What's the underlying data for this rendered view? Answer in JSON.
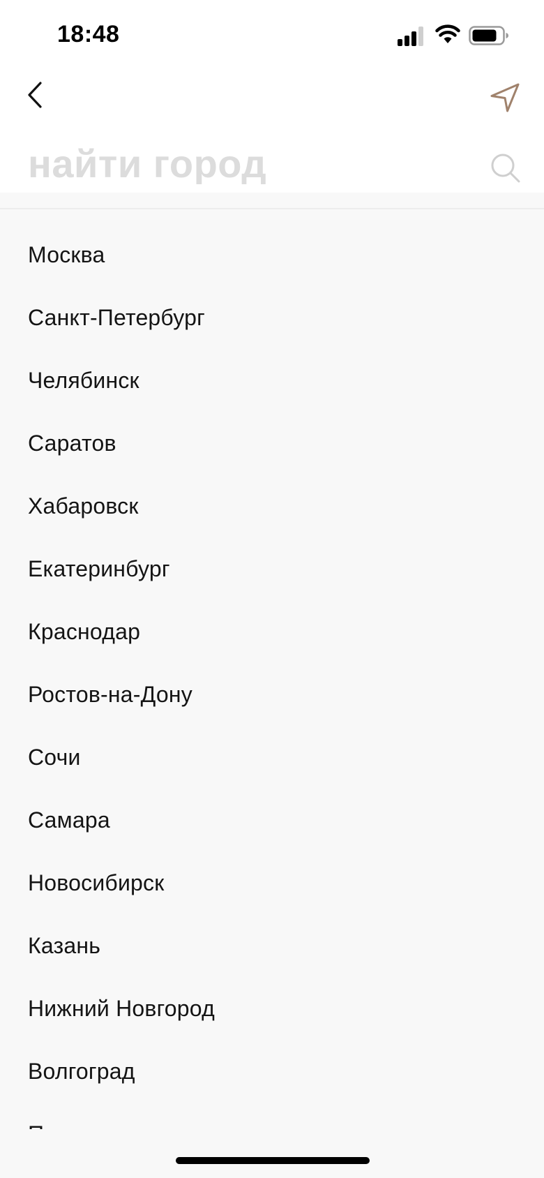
{
  "status_bar": {
    "time": "18:48",
    "icons": [
      "signal-icon",
      "wifi-icon",
      "battery-icon"
    ]
  },
  "header": {
    "back_icon": "chevron-left-icon",
    "locate_icon": "location-arrow-icon",
    "search_placeholder": "найти город",
    "search_value": "",
    "search_icon": "search-icon"
  },
  "cities": [
    "Москва",
    "Санкт-Петербург",
    "Челябинск",
    "Саратов",
    "Хабаровск",
    "Екатеринбург",
    "Краснодар",
    "Ростов-на-Дону",
    "Сочи",
    "Самара",
    "Новосибирск",
    "Казань",
    "Нижний Новгород",
    "Волгоград",
    "Пермь"
  ],
  "colors": {
    "accent": "#a0826c",
    "placeholder": "#dcdcdc",
    "list_background": "#f8f8f8",
    "header_background": "#ffffff",
    "text": "#141414"
  }
}
